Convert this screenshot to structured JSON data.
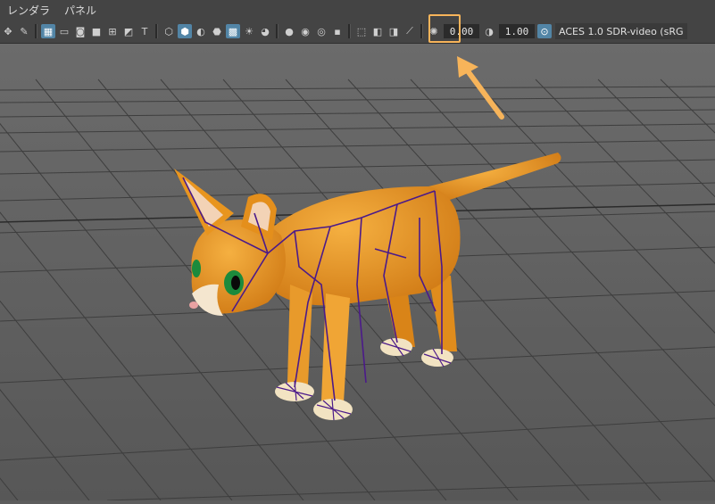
{
  "menubar": {
    "items": [
      "レンダラ",
      "パネル"
    ]
  },
  "toolbar": {
    "exposure_value": "0.00",
    "gamma_value": "1.00",
    "colorspace_label": "ACES 1.0 SDR-video (sRG",
    "icons": [
      "move-icon",
      "pencil-icon",
      "grid-icon",
      "film-gate-icon",
      "resolution-gate-icon",
      "gate-mask-icon",
      "field-chart-icon",
      "safe-action-icon",
      "safe-title-icon",
      "wireframe-icon",
      "smooth-shade-icon",
      "default-material-icon",
      "textured-icon",
      "xray-icon",
      "lights-icon",
      "shadows-icon",
      "ambient-occlusion-icon",
      "motion-blur-icon",
      "anti-alias-icon",
      "isolate-select-icon",
      "xray-joints-icon",
      "joint-display-icon",
      "exposure-icon",
      "gamma-icon",
      "color-management-icon"
    ]
  },
  "colors": {
    "accent_highlight": "#f7b45a",
    "active_button": "#5285a6",
    "cat_body": "#e7941f",
    "skeleton": "#4b1a8a"
  }
}
